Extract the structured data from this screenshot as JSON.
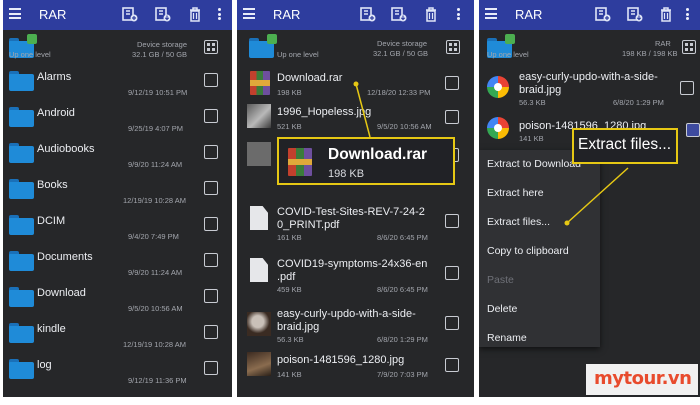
{
  "app_title": "RAR",
  "storage": {
    "label": "Device storage",
    "usage": "32.1 GB / 50 GB",
    "up": "Up one level"
  },
  "panel1": {
    "folders": [
      {
        "name": "Alarms",
        "date": "9/12/19 10:51 PM"
      },
      {
        "name": "Android",
        "date": "9/25/19 4:07 PM"
      },
      {
        "name": "Audiobooks",
        "date": "9/9/20 11:24 AM"
      },
      {
        "name": "Books",
        "date": "12/19/19 10:28 AM"
      },
      {
        "name": "DCIM",
        "date": "9/4/20 7:49 PM"
      },
      {
        "name": "Documents",
        "date": "9/9/20 11:24 AM"
      },
      {
        "name": "Download",
        "date": "9/5/20 10:56 AM"
      },
      {
        "name": "kindle",
        "date": "12/19/19 10:28 AM"
      },
      {
        "name": "log",
        "date": "9/12/19 11:36 PM"
      }
    ]
  },
  "panel2": {
    "files": [
      {
        "name": "Download.rar",
        "size": "198 KB",
        "date": "12/18/20 12:33 PM"
      },
      {
        "name": "1996_Hopeless.jpg",
        "size": "521 KB",
        "date": "9/5/20 10:56 AM"
      },
      {
        "name": "",
        "size": "71.5 KB",
        "date": "8/5/20 10:56 AM"
      },
      {
        "name": "COVID-Test-Sites-REV-7-24-2",
        "name2": "0_PRINT.pdf",
        "size": "161 KB",
        "date": "8/6/20 6:45 PM"
      },
      {
        "name": "COVID19-symptoms-24x36-en",
        "name2": ".pdf",
        "size": "459 KB",
        "date": "8/6/20 6:45 PM"
      },
      {
        "name": "easy-curly-updo-with-a-side-",
        "name2": "braid.jpg",
        "size": "56.3 KB",
        "date": "6/8/20 1:29 PM"
      },
      {
        "name": "poison-1481596_1280.jpg",
        "size": "141 KB",
        "date": "7/9/20 7:03 PM"
      }
    ],
    "callout": {
      "name": "Download.rar",
      "size": "198 KB"
    }
  },
  "panel3": {
    "header": {
      "label": "RAR",
      "size": "198 KB / 198 KB",
      "up": "Up one level"
    },
    "files": [
      {
        "name": "easy-curly-updo-with-a-side-",
        "name2": "braid.jpg",
        "size": "56.3 KB",
        "date": "6/8/20 1:29 PM"
      },
      {
        "name": "poison-1481596_1280.jpg",
        "size": "141 KB"
      }
    ],
    "menu": [
      "Extract to Download",
      "Extract here",
      "Extract files...",
      "Copy to clipboard",
      "Paste",
      "Delete",
      "Rename"
    ],
    "callout": "Extract files..."
  },
  "brand": "mytour.vn",
  "colors": {
    "appbar": "#2e3d9e",
    "panel_bg": "#262729",
    "folder": "#1f8bd8",
    "highlight": "#e6c814",
    "brand": "#e84b2d"
  },
  "icons": [
    "menu-icon",
    "add-archive-icon",
    "extract-archive-icon",
    "trash-icon",
    "more-vert-icon",
    "folder-icon",
    "grid-view-icon",
    "checkbox-icon",
    "rar-file-icon",
    "pdf-file-icon",
    "google-photos-icon"
  ]
}
